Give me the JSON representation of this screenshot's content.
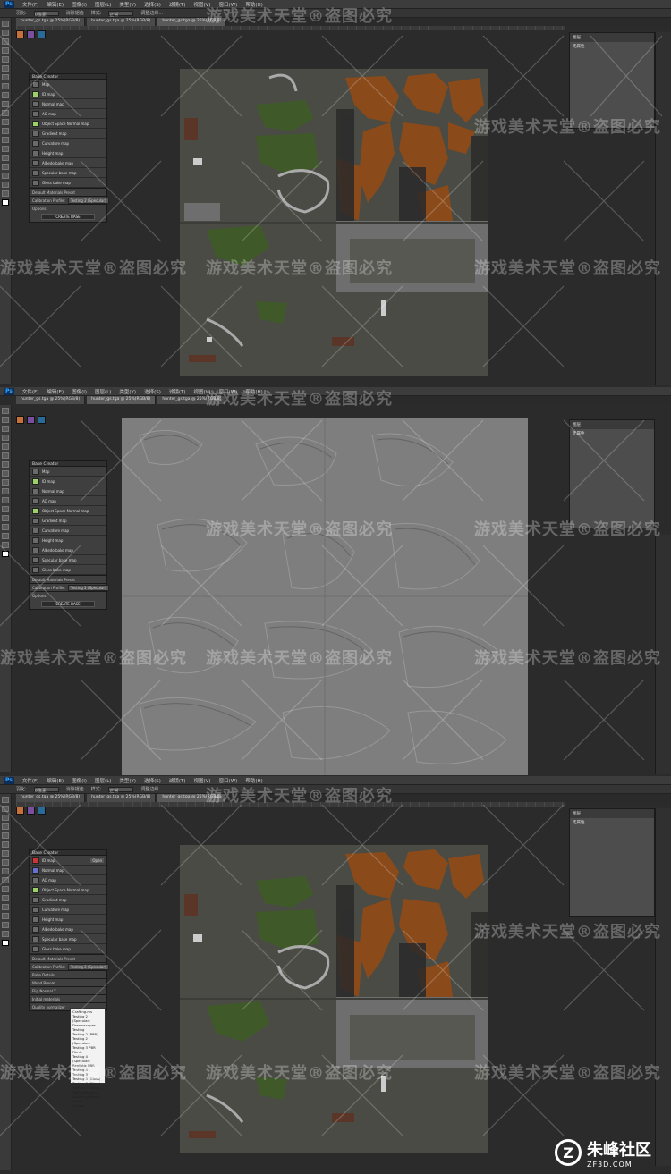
{
  "app": {
    "logo": "Ps"
  },
  "menu": [
    "文件(F)",
    "编辑(E)",
    "图像(I)",
    "图层(L)",
    "类型(Y)",
    "选择(S)",
    "滤镜(T)",
    "视图(V)",
    "窗口(W)",
    "帮助(H)"
  ],
  "options_bar": {
    "label1": "羽化:",
    "value1": "0像素",
    "label2": "消除锯齿",
    "label3": "样式:",
    "value3": "正常",
    "label4": "调整边缘..."
  },
  "tabs": [
    "hunter_gs.tga @ 25%(RGB/8)",
    "hunter_gs.tga @ 25%(RGB/8)",
    "hunter_gs.tga @ 25%(RGB/8)"
  ],
  "bake_panel": {
    "title": "Bake Creator",
    "items": [
      "Map",
      "ID map",
      "Normal map",
      "AO map",
      "Object Space Normal map",
      "Gradient map",
      "Curvature map",
      "Height map",
      "Albedo bake map",
      "Specular bake map",
      "Gloss bake map"
    ],
    "preset_label": "Default Materials Preset",
    "calibration_label": "Calibration Profile:",
    "calibration_value": "Testing 2 (Specular)",
    "options_label": "Options",
    "create_button": "CREATE BASE",
    "open_button": "Open",
    "third_options": [
      "Crafting.ms",
      "Bake Details",
      "Wood Broom",
      "Flip Normal Y",
      "Initial materials",
      "Quality normalizer"
    ]
  },
  "dropdown": {
    "options": [
      "Crafting.ms",
      "Testing 2 (Specular)",
      "Dreamscapes",
      "Testing",
      "Testing 2 (PBR)",
      "Testing 2 (Specular)",
      "Testing 3 PBR Filmic",
      "Testing 4 (Specular)",
      "Realistic PBR",
      "Testing 4 - Testing 3",
      "Testing 3 (Gloss)",
      "Testing 3 (Gloss)",
      "Testing 2 (Gloss)",
      "Tool (optional)",
      "Studio (optional)",
      "Game",
      "Gallery"
    ]
  },
  "layers_panel": {
    "title": "图层",
    "subtitle": "无属性"
  },
  "watermark": {
    "text1": "游戏美术天堂®盗图必究",
    "text2": "游戏美术天堂®盗图必究"
  },
  "logo": {
    "mark": "Z",
    "cn": "朱峰社区",
    "en": "ZF3D.COM"
  },
  "colors": {
    "orange": "#8a4a1a",
    "green": "#3f5a28",
    "canvas": "#4a4b45",
    "normal_gray": "#7e7e7e"
  }
}
